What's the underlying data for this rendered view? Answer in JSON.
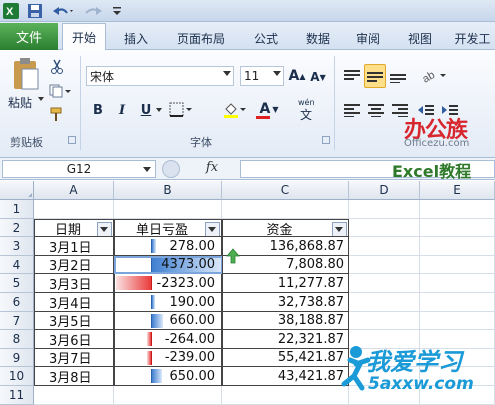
{
  "ribbon_tabs": {
    "file": "文件",
    "home": "开始",
    "insert": "插入",
    "page_layout": "页面布局",
    "formulas": "公式",
    "data": "数据",
    "review": "审阅",
    "view": "视图",
    "developer": "开发工"
  },
  "clipboard": {
    "paste_label": "粘贴",
    "group_label": "剪贴板"
  },
  "font": {
    "name": "宋体",
    "size": "11",
    "bold": "B",
    "italic": "I",
    "underline": "U",
    "grow": "A",
    "shrink": "A",
    "font_color": "A",
    "wen": "wén",
    "wen_char": "文",
    "group_label": "字体"
  },
  "watermarks": {
    "office_brand": "办公族",
    "office_url": "Officezu.com",
    "excel_tutorial": "Excel教程",
    "xue_brand": "我爱学习",
    "xue_url": "5axxw.com"
  },
  "formula_bar": {
    "name_box": "G12",
    "fx": "fx",
    "value": ""
  },
  "columns": [
    "A",
    "B",
    "C",
    "D",
    "E"
  ],
  "rows": [
    "1",
    "2",
    "3",
    "4",
    "5",
    "6",
    "7",
    "8",
    "9",
    "10",
    "11"
  ],
  "table": {
    "headers": [
      "日期",
      "单日亏盈",
      "资金"
    ],
    "records": [
      {
        "date": "3月1日",
        "pl": "278.00",
        "pl_value": 278,
        "capital": "136,868.87"
      },
      {
        "date": "3月2日",
        "pl": "4373.00",
        "pl_value": 4373,
        "capital": "7,808.80"
      },
      {
        "date": "3月3日",
        "pl": "-2323.00",
        "pl_value": -2323,
        "capital": "11,277.87"
      },
      {
        "date": "3月4日",
        "pl": "190.00",
        "pl_value": 190,
        "capital": "32,738.87"
      },
      {
        "date": "3月5日",
        "pl": "660.00",
        "pl_value": 660,
        "capital": "38,188.87"
      },
      {
        "date": "3月6日",
        "pl": "-264.00",
        "pl_value": -264,
        "capital": "22,321.87"
      },
      {
        "date": "3月7日",
        "pl": "-239.00",
        "pl_value": -239,
        "capital": "55,421.87"
      },
      {
        "date": "3月8日",
        "pl": "650.00",
        "pl_value": 650,
        "capital": "43,421.87"
      }
    ]
  },
  "colors": {
    "positive_bar": "#3f7fd1",
    "negative_bar": "#e93b3b",
    "file_tab": "#2a7f30",
    "arrow_up": "#4caf50"
  }
}
